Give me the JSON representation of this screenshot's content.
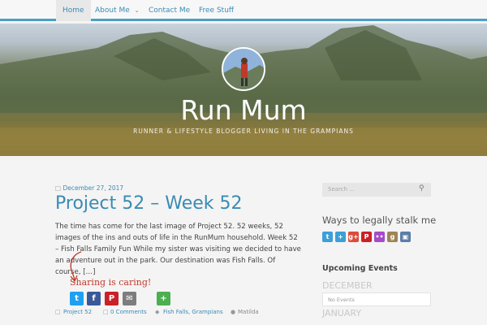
{
  "nav": {
    "items": [
      {
        "label": "Home",
        "active": true
      },
      {
        "label": "About Me",
        "has_dropdown": true
      },
      {
        "label": "Contact Me"
      },
      {
        "label": "Free Stuff"
      }
    ]
  },
  "header": {
    "title": "Run Mum",
    "tagline": "RUNNER & LIFESTYLE BLOGGER LIVING IN THE GRAMPIANS"
  },
  "post": {
    "date": "December 27, 2017",
    "title": "Project 52 – Week 52",
    "excerpt": "The time has come for the last image of Project 52. 52 weeks, 52 images of the ins and outs of life in the RunMum household. Week 52 – Fish Falls Family Fun While my sister was visiting we decided to have an adventure out in the park. Our destination was Fish Falls. Of course, […]",
    "sharing_label": "Sharing is caring!",
    "share_buttons": [
      {
        "name": "twitter",
        "glyph": "t",
        "color": "#1da1f2"
      },
      {
        "name": "facebook",
        "glyph": "f",
        "color": "#3b5998"
      },
      {
        "name": "pinterest",
        "glyph": "P",
        "color": "#cb2027"
      },
      {
        "name": "email",
        "glyph": "✉",
        "color": "#7d7d7d"
      },
      {
        "name": "more",
        "glyph": "+",
        "color": "#4caf50"
      }
    ],
    "meta": {
      "category": "Project 52",
      "comments": "0 Comments",
      "tags": "Fish Falls, Grampians",
      "author": "Matilda"
    }
  },
  "sidebar": {
    "search_placeholder": "Search ...",
    "social_title": "Ways to legally stalk me",
    "social_icons": [
      {
        "name": "twitter",
        "glyph": "t",
        "color": "#3b9fd8"
      },
      {
        "name": "plus",
        "glyph": "+",
        "color": "#3b9fd8"
      },
      {
        "name": "google-plus",
        "glyph": "g+",
        "color": "#dd4b39"
      },
      {
        "name": "pinterest",
        "glyph": "P",
        "color": "#cb2027"
      },
      {
        "name": "flickr",
        "glyph": "••",
        "color": "#a64ac9"
      },
      {
        "name": "goodreads",
        "glyph": "g",
        "color": "#a08455"
      },
      {
        "name": "instagram",
        "glyph": "▣",
        "color": "#5a7ea8"
      }
    ],
    "events_title": "Upcoming Events",
    "months": [
      {
        "label": "DECEMBER",
        "status": "No Events"
      },
      {
        "label": "JANUARY"
      }
    ]
  }
}
